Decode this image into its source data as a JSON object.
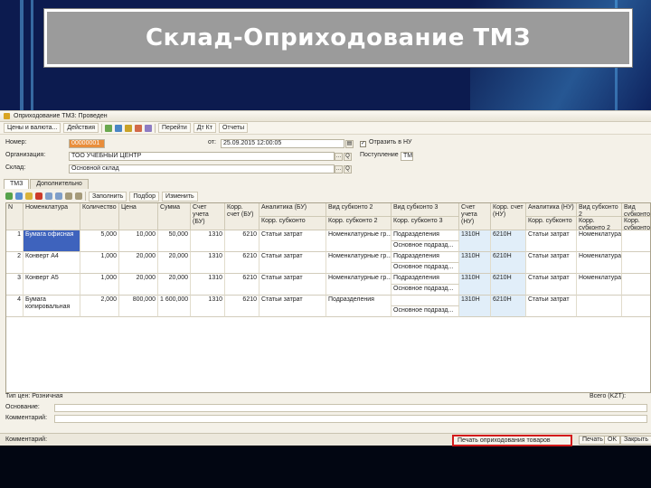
{
  "slide_title": "Склад-Оприходование ТМЗ",
  "window": {
    "title": "Оприходование ТМЗ: Проведен",
    "toolbar": [
      "Цены и валюта...",
      "Действия",
      "Перейти",
      "Дт Кт",
      "Отчеты"
    ]
  },
  "form": {
    "number_label": "Номер:",
    "number_value": "00000001",
    "from_label": "от:",
    "date_value": "25.09.2015 12:00:05",
    "reflect_nu_label": "Отразить в НУ",
    "org_label": "Организация:",
    "org_value": "ТОО УЧЕБНЫЙ ЦЕНТР",
    "warehouse_label": "Склад:",
    "warehouse_value": "Основной склад",
    "sklad_nu_label": "Поступление",
    "sklad_nu_value": "ТМЗ"
  },
  "tabs": [
    "ТМЗ",
    "Дополнительно"
  ],
  "table_toolbar": [
    "Заполнить",
    "Подбор",
    "Изменить"
  ],
  "table": {
    "headers": [
      "N",
      "Номенклатура",
      "Количество",
      "Цена",
      "Сумма",
      "Счет учета (БУ)",
      "Корр. счет (БУ)",
      "Аналитика (БУ)",
      "Вид субконто 2",
      "Вид субконто 3",
      "Счет учета (НУ)",
      "Корр. счет (НУ)",
      "Аналитика (НУ)",
      "Вид субконто 2",
      "Вид субконто 3"
    ],
    "subheaders": [
      "Корр. субконто",
      "Корр. субконто 2",
      "Корр. субконто 3",
      "Корр. субконто",
      "Корр. субконто 2",
      "Корр. субконто 3"
    ],
    "rows": [
      {
        "n": "1",
        "name": "Бумага офисная",
        "qty": "5,000",
        "price": "10,000",
        "sum": "50,000",
        "acc_bu": "1310",
        "corr_bu": "6210",
        "an1": "Статьи затрат",
        "an2": "Номенклатурные гр...",
        "an3": "Подразделения",
        "an3b": "Основное подразд...",
        "acc_nu": "1310Н",
        "corr_nu": "6210Н",
        "nu1": "Статьи затрат",
        "nu2": "Номенклатура",
        "nu3": ""
      },
      {
        "n": "2",
        "name": "Конверт А4",
        "qty": "1,000",
        "price": "20,000",
        "sum": "20,000",
        "acc_bu": "1310",
        "corr_bu": "6210",
        "an1": "Статьи затрат",
        "an2": "Номенклатурные гр...",
        "an3": "Подразделения",
        "an3b": "Основное подразд...",
        "acc_nu": "1310Н",
        "corr_nu": "6210Н",
        "nu1": "Статьи затрат",
        "nu2": "Номенклатура",
        "nu3": ""
      },
      {
        "n": "3",
        "name": "Конверт А5",
        "qty": "1,000",
        "price": "20,000",
        "sum": "20,000",
        "acc_bu": "1310",
        "corr_bu": "6210",
        "an1": "Статьи затрат",
        "an2": "Номенклатурные гр...",
        "an3": "Подразделения",
        "an3b": "Основное подразд...",
        "acc_nu": "1310Н",
        "corr_nu": "6210Н",
        "nu1": "Статьи затрат",
        "nu2": "Номенклатура",
        "nu3": ""
      },
      {
        "n": "4",
        "name": "Бумага копировальная",
        "qty": "2,000",
        "price": "800,000",
        "sum": "1 600,000",
        "acc_bu": "1310",
        "corr_bu": "6210",
        "an1": "Статьи затрат",
        "an2": "Подразделения",
        "an3": "",
        "an3b": "Основное подразд...",
        "acc_nu": "1310Н",
        "corr_nu": "6210Н",
        "nu1": "Статьи затрат",
        "nu2": "",
        "nu3": ""
      }
    ]
  },
  "footer": {
    "type_label": "Тип цен: Розничная",
    "total_label": "Всего (KZT):",
    "comment_label": "Основание:",
    "comment2_label": "Комментарий:",
    "left_label": "Комментарий:",
    "print_highlight": "Печать оприходования товаров",
    "print_btn": "Печать",
    "ok_btn": "OK",
    "close_btn": "Закрыть"
  },
  "colors": {
    "banner": "#9b9b9b",
    "selected_row": "#3e63bd",
    "redbox": "#d31b1b",
    "number_field": "#e98d3a"
  }
}
